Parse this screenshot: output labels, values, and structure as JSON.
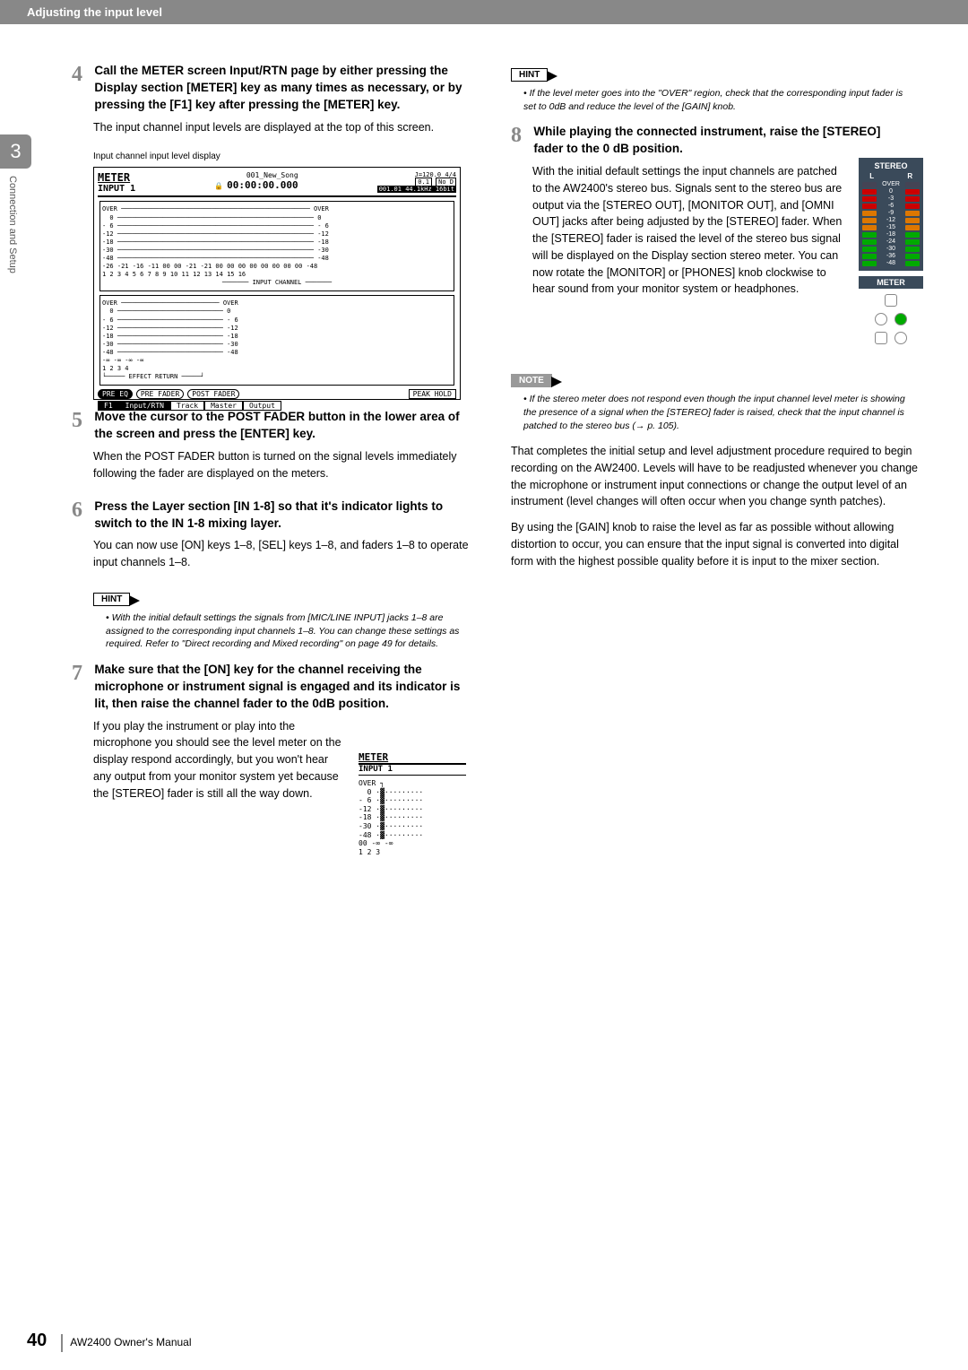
{
  "header": {
    "section_title": "Adjusting the input level"
  },
  "sidebar": {
    "chapter_number": "3",
    "tab_label": "Connection and Setup"
  },
  "footer": {
    "page": "40",
    "manual_title": "AW2400  Owner's Manual"
  },
  "left": {
    "step4": {
      "num": "4",
      "head": "Call the METER screen Input/RTN page by either pressing the Display section [METER] key as many times as necessary, or by pressing the [F1] key after pressing the [METER] key.",
      "body": "The input channel input levels are displayed at the top of this screen.",
      "caption": "Input channel input level display"
    },
    "screen": {
      "title": "METER",
      "subtitle": "INPUT 1",
      "top_info": "001_New_Song",
      "time": "00:00:00.000",
      "tempo": "J=120.0  4/4",
      "rate_left": "0.1",
      "rate_right_a": "No  D",
      "srate": "001.01  44.1kHz  16bit",
      "scale_labels": "OVER  0  -6  -12  -18  -30  -48",
      "footer_labels": "-26 -21 -16 -11  00  00 -21 -21  00  00  00  00  00  00  00  00  -48",
      "channel_nums": "1  2  3  4   5  6  7  8   9 10 11 12  13 14 15 16",
      "section_a": "INPUT CHANNEL",
      "section_b": "EFFECT RETURN",
      "return_vals": "-∞   -∞   -∞   -∞",
      "return_nums": "1    2    3    4",
      "btn_pre_eq": "PRE EQ",
      "btn_pre_fader": "PRE FADER",
      "btn_post_fader": "POST FADER",
      "btn_peak": "PEAK HOLD",
      "tab1": "Input/RTN",
      "tab2": "Track",
      "tab3": "Master",
      "tab4": "Output",
      "f1": "F1"
    },
    "step5": {
      "num": "5",
      "head": "Move the cursor to the POST FADER button in the lower area of the screen and press the [ENTER] key.",
      "body": "When the POST FADER button is turned on the signal levels immediately following the fader are displayed on the meters."
    },
    "step6": {
      "num": "6",
      "head": "Press the Layer section [IN 1-8] so that it's indicator lights to switch to the IN 1-8 mixing layer.",
      "body": "You can now use [ON] keys 1–8, [SEL] keys 1–8, and faders 1–8 to operate input channels 1–8."
    },
    "hint6": {
      "label": "HINT",
      "body": "• With the initial default settings the signals from [MIC/LINE INPUT] jacks 1–8 are assigned to the corresponding input channels 1–8. You can change these settings as required. Refer to \"Direct recording and Mixed recording\" on page 49 for details."
    },
    "step7": {
      "num": "7",
      "head": "Make sure that the [ON] key for the channel receiving the microphone or instrument signal is engaged and its indicator is lit, then raise the channel fader to the 0dB position.",
      "body": "If you play the instrument or play into the microphone you should see the level meter on the display respond accordingly, but you won't hear any output from your monitor system yet because the [STEREO] fader is still all the way down."
    },
    "screen_small": {
      "title": "METER",
      "subtitle": "INPUT 1",
      "scale": "OVER\n  0\n- 6\n-12\n-18\n-30\n-48",
      "footer": "00 -∞ -∞",
      "nums": "1   2   3"
    }
  },
  "right": {
    "hint_top": {
      "label": "HINT",
      "body": "• If the level meter goes into the \"OVER\" region, check that the corresponding input fader is set to 0dB and reduce the level of the [GAIN] knob."
    },
    "step8": {
      "num": "8",
      "head": "While playing the connected instrument, raise the [STEREO] fader to the 0 dB position.",
      "body": "With the initial default settings the input channels are patched to the AW2400's stereo bus. Signals sent to the stereo bus are output via the [STEREO OUT], [MONITOR OUT], and [OMNI OUT] jacks after being adjusted by the [STEREO] fader. When the [STEREO] fader is raised the level of the stereo bus signal will be displayed on the Display section stereo meter. You can now rotate the [MONITOR] or [PHONES] knob clockwise to hear sound from your monitor system or headphones."
    },
    "stereo_meter": {
      "title": "STEREO",
      "L": "L",
      "R": "R",
      "rows": [
        "OVER",
        "0",
        "-3",
        "-6",
        "-9",
        "-12",
        "-15",
        "-18",
        "-24",
        "-30",
        "-36",
        "-48"
      ],
      "meter_label": "METER"
    },
    "note": {
      "label": "NOTE",
      "body": "• If the stereo meter does not respond even though the input channel level meter is showing the presence of a signal when the [STEREO] fader is raised, check that the input channel is patched to the stereo bus (→ p. 105)."
    },
    "para1": "That completes the initial setup and level adjustment procedure required to begin recording on the AW2400. Levels will have to be readjusted whenever you change the microphone or instrument input connections or change the output level of an instrument (level changes will often occur when you change synth patches).",
    "para2": "By using the [GAIN] knob to raise the level as far as possible without allowing distortion to occur, you can ensure that the input signal is converted into digital form with the highest possible quality before it is input to the mixer section."
  }
}
